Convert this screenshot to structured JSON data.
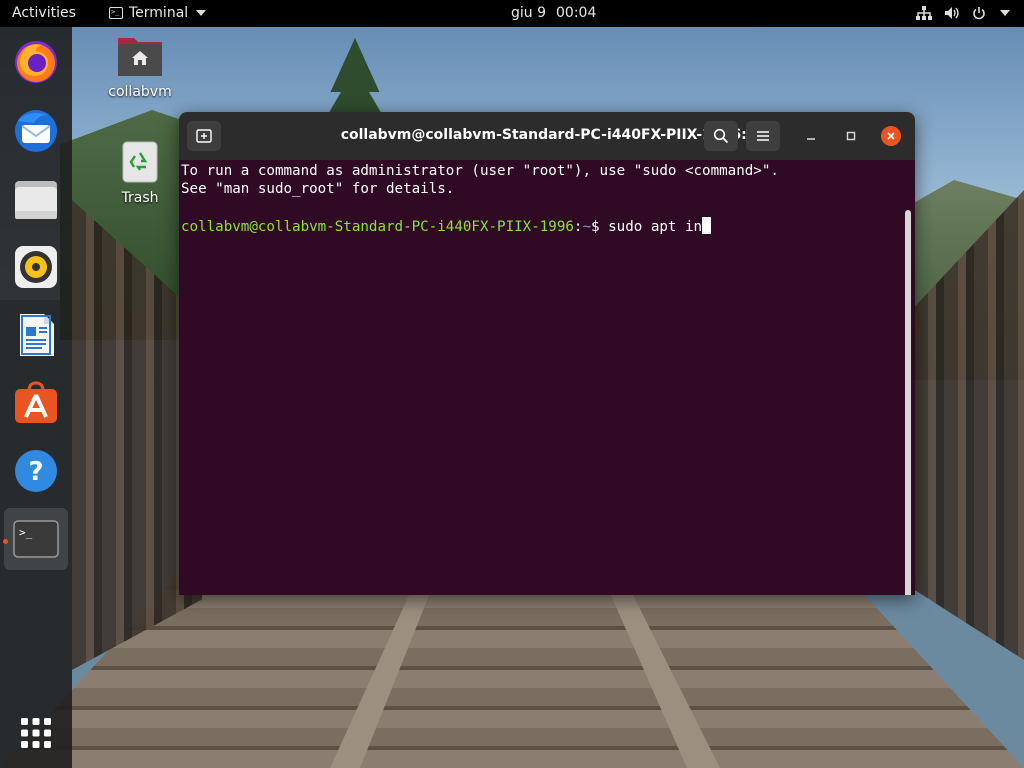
{
  "topbar": {
    "activities": "Activities",
    "app_name": "Terminal",
    "date": "giu 9",
    "time": "00:04"
  },
  "dock": {
    "items": [
      {
        "name": "Firefox",
        "icon": "firefox-icon"
      },
      {
        "name": "Thunderbird",
        "icon": "thunderbird-icon"
      },
      {
        "name": "Files",
        "icon": "files-icon"
      },
      {
        "name": "Rhythmbox",
        "icon": "rhythmbox-icon"
      },
      {
        "name": "LibreOffice Writer",
        "icon": "writer-icon"
      },
      {
        "name": "Ubuntu Software",
        "icon": "software-icon"
      },
      {
        "name": "Help",
        "icon": "help-icon"
      },
      {
        "name": "Terminal",
        "icon": "terminal-icon"
      }
    ],
    "show_apps_icon": "grid-icon"
  },
  "desktop": {
    "home_label": "collabvm",
    "trash_label": "Trash"
  },
  "window": {
    "title": "collabvm@collabvm-Standard-PC-i440FX-PIIX-1996: ~",
    "controls": {
      "minimize": "minimize-icon",
      "maximize": "maximize-icon",
      "close": "close-icon"
    }
  },
  "terminal": {
    "line1": "To run a command as administrator (user \"root\"), use \"sudo <command>\".",
    "line2": "See \"man sudo_root\" for details.",
    "prompt_user": "collabvm@collabvm-Standard-PC-i440FX-PIIX-1996",
    "prompt_sep": ":",
    "prompt_path": "~",
    "prompt_symbol": "$ ",
    "command": "sudo apt in"
  },
  "colors": {
    "terminal_bg": "#300a24",
    "prompt_user": "#8ae234",
    "prompt_path": "#729fcf",
    "accent": "#e95420"
  }
}
